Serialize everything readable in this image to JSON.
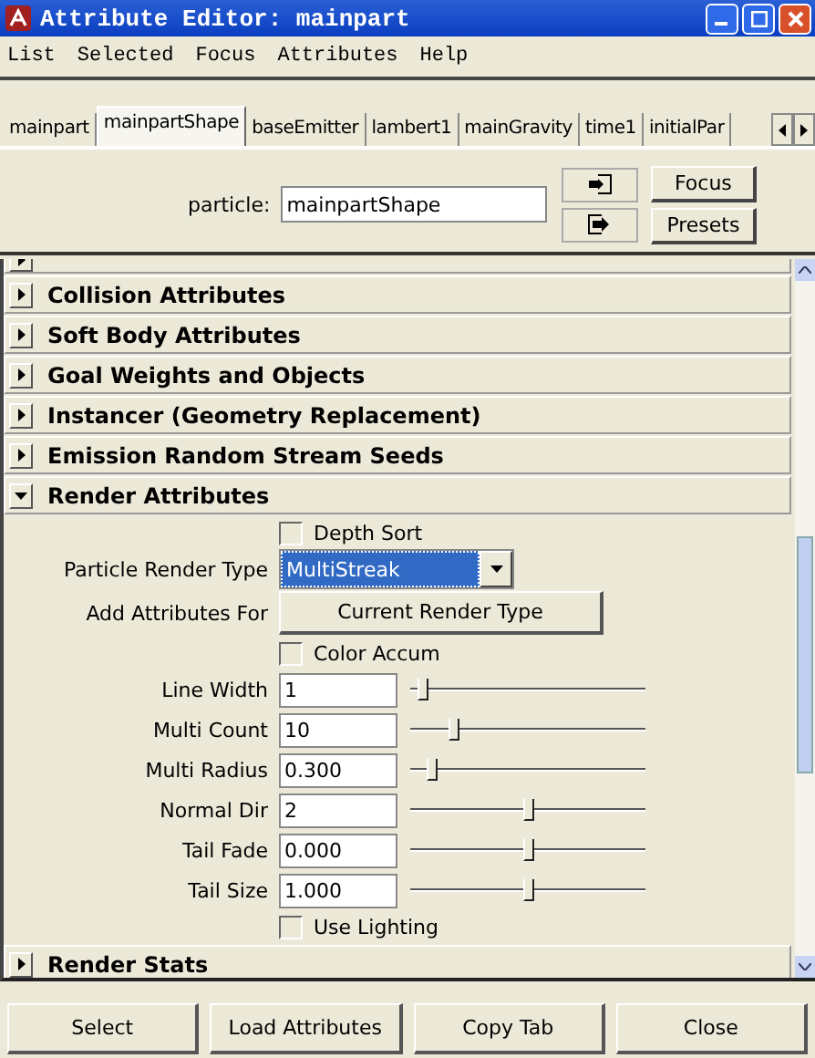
{
  "window": {
    "title": "Attribute Editor: mainpart"
  },
  "menu": [
    "List",
    "Selected",
    "Focus",
    "Attributes",
    "Help"
  ],
  "tabs": [
    {
      "label": "mainpart",
      "selected": false
    },
    {
      "label": "mainpartShape",
      "selected": true
    },
    {
      "label": "baseEmitter",
      "selected": false
    },
    {
      "label": "lambert1",
      "selected": false
    },
    {
      "label": "mainGravity",
      "selected": false
    },
    {
      "label": "time1",
      "selected": false
    },
    {
      "label": "initialPar",
      "selected": false
    }
  ],
  "node": {
    "label": "particle:",
    "value": "mainpartShape"
  },
  "side_buttons": [
    "Focus",
    "Presets"
  ],
  "sections": [
    {
      "expanded": false,
      "cut": true
    },
    {
      "title": "Collision Attributes",
      "expanded": false
    },
    {
      "title": "Soft Body Attributes",
      "expanded": false
    },
    {
      "title": "Goal Weights and Objects",
      "expanded": false
    },
    {
      "title": "Instancer (Geometry Replacement)",
      "expanded": false
    },
    {
      "title": "Emission Random Stream Seeds",
      "expanded": false
    },
    {
      "title": "Render Attributes",
      "expanded": true,
      "controls": [
        {
          "kind": "checkbox",
          "label": "Depth Sort",
          "checked": false
        },
        {
          "kind": "dropdown",
          "label": "Particle Render Type",
          "value": "MultiStreak"
        },
        {
          "kind": "button",
          "label": "Add Attributes For",
          "button": "Current Render Type"
        },
        {
          "kind": "checkbox",
          "label": "Color Accum",
          "checked": false
        },
        {
          "kind": "slider",
          "label": "Line Width",
          "value": "1",
          "level": 0.03
        },
        {
          "kind": "slider",
          "label": "Multi Count",
          "value": "10",
          "level": 0.17
        },
        {
          "kind": "slider",
          "label": "Multi Radius",
          "value": "0.300",
          "level": 0.07
        },
        {
          "kind": "slider",
          "label": "Normal Dir",
          "value": "2",
          "level": 0.5
        },
        {
          "kind": "slider",
          "label": "Tail Fade",
          "value": "0.000",
          "level": 0.5
        },
        {
          "kind": "slider",
          "label": "Tail Size",
          "value": "1.000",
          "level": 0.5
        },
        {
          "kind": "checkbox",
          "label": "Use Lighting",
          "checked": false
        }
      ]
    },
    {
      "title": "Render Stats",
      "expanded": false
    }
  ],
  "buttons": [
    "Select",
    "Load Attributes",
    "Copy Tab",
    "Close"
  ]
}
